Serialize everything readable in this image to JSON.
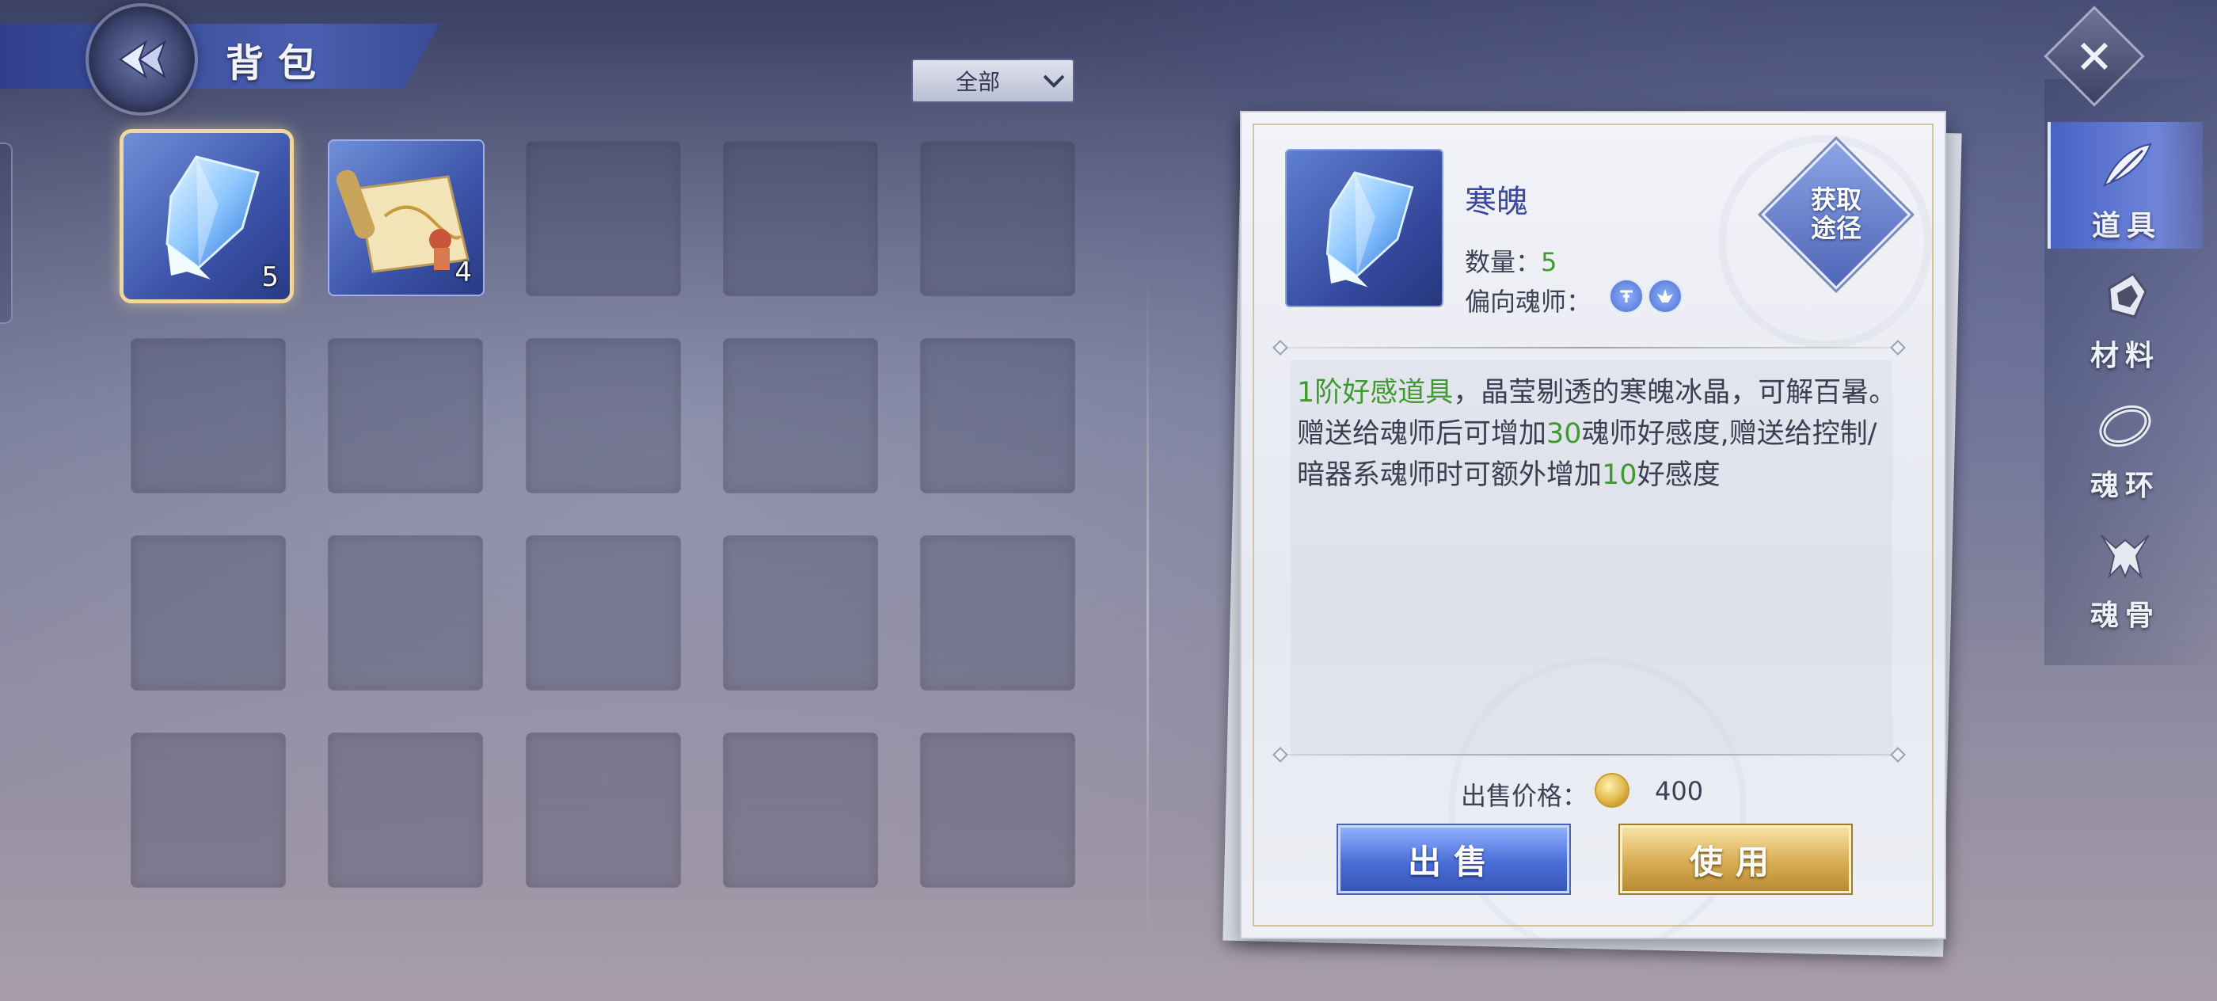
{
  "header": {
    "title": "背包"
  },
  "filter": {
    "selected": "全部"
  },
  "inventory": {
    "items": [
      {
        "name": "寒魄",
        "count": "5",
        "icon": "ice-crystal-icon"
      },
      {
        "name": "",
        "count": "4",
        "icon": "scroll-map-icon"
      }
    ]
  },
  "detail": {
    "name": "寒魄",
    "quantity_label": "数量：",
    "quantity": "5",
    "preferred_label": "偏向魂师：",
    "preferred_icons": [
      "control-type-icon",
      "hidden-weapon-type-icon"
    ],
    "source_button": "获取\n途径",
    "description": {
      "p1_hl": "1阶好感道具",
      "p1": "，晶莹剔透的寒魄冰晶，可解百暑。赠送给魂师后可增加",
      "v1": "30",
      "p2": "魂师好感度,赠送给控制/暗器系魂师时可额外增加",
      "v2": "10",
      "p3": "好感度"
    },
    "price_label": "出售价格：",
    "price": "400",
    "sell_button": "出售",
    "use_button": "使用"
  },
  "nav": {
    "tabs": [
      {
        "label": "道具",
        "icon": "feather-icon",
        "active": true
      },
      {
        "label": "材料",
        "icon": "material-crystal-icon",
        "active": false
      },
      {
        "label": "魂环",
        "icon": "soul-ring-icon",
        "active": false
      },
      {
        "label": "魂骨",
        "icon": "soul-bone-icon",
        "active": false
      }
    ]
  },
  "colors": {
    "accent_blue": "#4962c4",
    "highlight_green": "#3f9b2f",
    "gold": "#d9ad54"
  }
}
